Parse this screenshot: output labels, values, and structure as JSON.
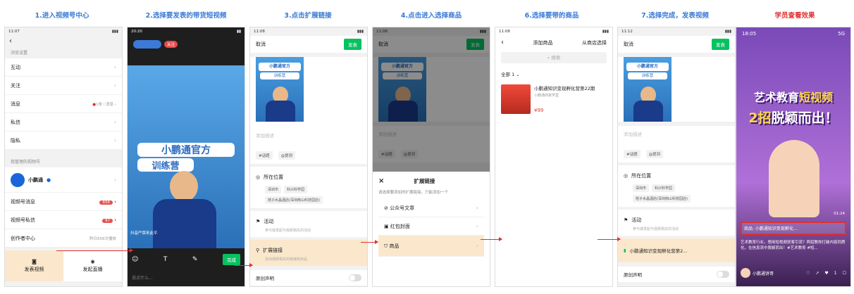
{
  "captions": [
    "1.进入视频号中心",
    "2.选择要发表的带货短视频",
    "3.点击扩展链接",
    "4.点击进入选择商品",
    "6.选择要带的商品",
    "7.选择完成，发表视频",
    "学员查看效果"
  ],
  "p1": {
    "time": "11:07",
    "back": "‹",
    "sec1": "浏览设置",
    "rows": [
      "互动",
      "关注",
      "消息",
      "私信",
      "隐私"
    ],
    "msg_hint": "1条♡消息",
    "sec2": "我管理的视频号",
    "account": "小鹏通",
    "rows2": [
      "视频号消息",
      "视频号私信",
      "创作者中心"
    ],
    "b1": "656",
    "b2": "97",
    "creator_hint": "昨日658次播放",
    "publish": "发表视频",
    "live": "发起直播"
  },
  "p2": {
    "time": "20:20",
    "follow": "关注",
    "title1": "小鹏通官方",
    "title2": "训练营",
    "subtitle": "抖音严禁来此平",
    "done": "完成",
    "comment": "说点什么..."
  },
  "edit": {
    "time3": "11:08",
    "time4": "11:08",
    "time7": "11:12",
    "cancel": "取消",
    "publish": "发表",
    "t1": "小鹏通官方",
    "t2": "训练营",
    "desc": "添加描述",
    "tag1": "#话题",
    "tag2": "@提到",
    "loc": "所在位置",
    "loc_chips": [
      "深圳市",
      "科兴科学园",
      "桔子水晶酒店(深圳南山科技园店)"
    ],
    "act": "活动",
    "act_sub": "参与或发起与视频相关的活动",
    "ext": "扩展链接",
    "ext_sub": "添加视频相关的链接和商品",
    "orig": "原创声明",
    "chosen": "小鹏通知识变现孵化营第2..."
  },
  "sheet": {
    "title": "扩展链接",
    "close": "×",
    "hint": "请选择要添加的扩展链接，只能添加一个",
    "opts": [
      "公众号文章",
      "红包封面",
      "商品"
    ]
  },
  "p5": {
    "time": "11:08",
    "back": "‹",
    "title": "添加商品",
    "shop": "从商店选择",
    "search": "搜索",
    "filter": "全部 1",
    "product": "小鹏通知识变现孵化营第22期",
    "store": "小鹏通商家学堂",
    "price": "¥99"
  },
  "p8": {
    "time": "18:05",
    "signal": "5G",
    "t1": "艺术教育",
    "t2": "短视频",
    "t3": "2招",
    "t4": "脱颖而出！",
    "tag": "商品: 小鹏通知识变现孵化...",
    "text": "艺术教育行业，想用短视频获客引流？两招教你打破内容同质化，在信息流中脱颖而出！#艺术教育 #短...",
    "user": "小鹏通饼哥",
    "dur": "01:24",
    "likes": "1"
  }
}
